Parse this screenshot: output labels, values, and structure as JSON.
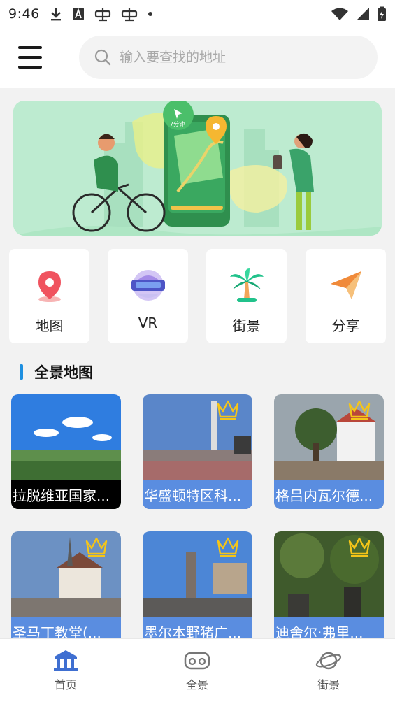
{
  "status_bar": {
    "time": "9:46",
    "icons": [
      "download-icon",
      "font-a-icon",
      "bug-icon",
      "bug-icon",
      "dot-icon"
    ],
    "right_icons": [
      "wifi-icon",
      "signal-icon",
      "battery-charging-icon"
    ]
  },
  "header": {
    "menu_icon": "hamburger-menu-icon",
    "search_placeholder": "输入要查找的地址"
  },
  "banner": {
    "badge_text": "7分钟"
  },
  "quick_actions": [
    {
      "label": "地图",
      "icon": "map-pin-icon"
    },
    {
      "label": "VR",
      "icon": "vr-goggles-icon"
    },
    {
      "label": "街景",
      "icon": "palm-tree-icon"
    },
    {
      "label": "分享",
      "icon": "paper-plane-icon"
    }
  ],
  "section": {
    "title": "全景地图"
  },
  "panoramas": [
    {
      "caption": "拉脱维亚国家...",
      "premium": false
    },
    {
      "caption": "华盛顿特区科...",
      "premium": true
    },
    {
      "caption": "格吕内瓦尔德...",
      "premium": true
    },
    {
      "caption": "圣马丁教堂(...",
      "premium": true
    },
    {
      "caption": "墨尔本野猪广...",
      "premium": true
    },
    {
      "caption": "迪舍尔·弗里...",
      "premium": true
    }
  ],
  "bottom_nav": [
    {
      "label": "首页",
      "icon": "bank-building-icon",
      "active": true
    },
    {
      "label": "全景",
      "icon": "vr-headset-icon",
      "active": false
    },
    {
      "label": "街景",
      "icon": "planet-icon",
      "active": false
    }
  ],
  "colors": {
    "accent": "#1e8fe0",
    "caption_blue": "#5a8de0",
    "crown_gold": "#f5c518",
    "banner_bg": "#bdebd0"
  }
}
